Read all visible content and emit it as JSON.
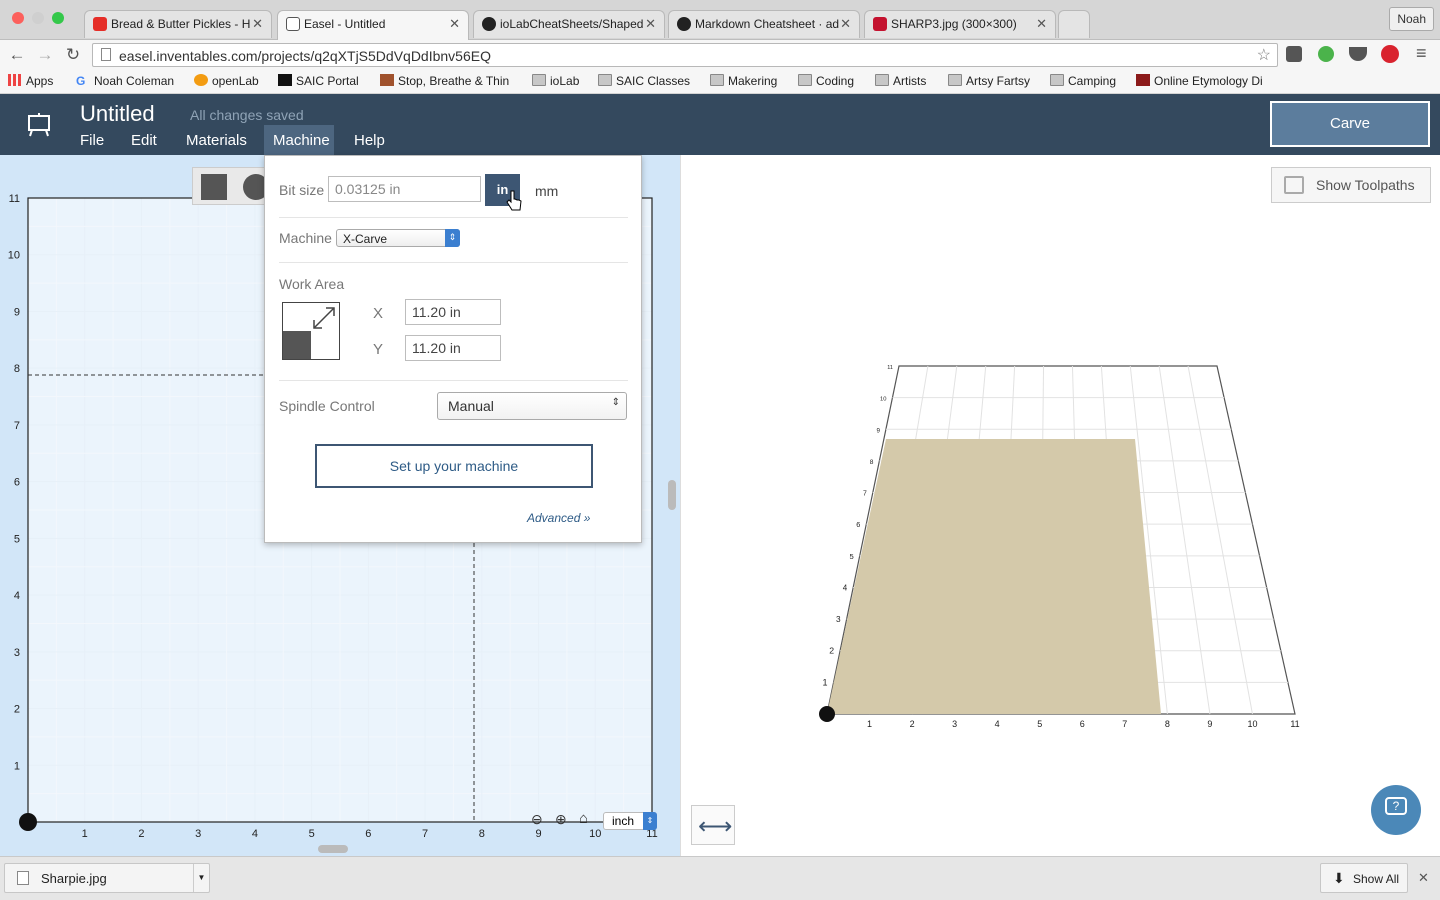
{
  "browser": {
    "tabs": [
      {
        "title": "Bread & Butter Pickles - H",
        "favicon": "youtube-icon"
      },
      {
        "title": "Easel - Untitled",
        "favicon": "easel-icon"
      },
      {
        "title": "ioLabCheatSheets/Shaped",
        "favicon": "github-icon"
      },
      {
        "title": "Markdown Cheatsheet · ad",
        "favicon": "github-icon"
      },
      {
        "title": "SHARP3.jpg (300×300)",
        "favicon": "image-icon"
      }
    ],
    "user": "Noah",
    "url": "easel.inventables.com/projects/q2qXTjS5DdVqDdIbnv56EQ",
    "bookmarks": [
      "Apps",
      "Noah Coleman",
      "openLab",
      "SAIC Portal",
      "Stop, Breathe & Thin",
      "ioLab",
      "SAIC Classes",
      "Makering",
      "Coding",
      "Artists",
      "Artsy Fartsy",
      "Camping",
      "Online Etymology Di"
    ]
  },
  "app": {
    "title": "Untitled",
    "save_status": "All changes saved",
    "menus": [
      "File",
      "Edit",
      "Materials",
      "Machine",
      "Help"
    ],
    "carve_label": "Carve",
    "accent": "#34495e"
  },
  "machine_panel": {
    "bit_size_label": "Bit size",
    "bit_size_value": "0.03125 in",
    "unit_in": "in",
    "unit_mm": "mm",
    "machine_label": "Machine",
    "machine_value": "X-Carve",
    "work_area_label": "Work Area",
    "x_label": "X",
    "x_value": "11.20 in",
    "y_label": "Y",
    "y_value": "11.20 in",
    "spindle_label": "Spindle Control",
    "spindle_value": "Manual",
    "setup_label": "Set up your machine",
    "advanced_label": "Advanced »"
  },
  "canvas": {
    "y_ticks": [
      "11",
      "10",
      "9",
      "8",
      "7",
      "6",
      "5",
      "4",
      "3",
      "2",
      "1"
    ],
    "x_ticks": [
      "1",
      "2",
      "3",
      "4",
      "5",
      "6",
      "7",
      "8",
      "9",
      "10",
      "11"
    ],
    "unit_select": "inch"
  },
  "preview": {
    "show_toolpaths_label": "Show Toolpaths",
    "x_ticks": [
      "1",
      "2",
      "3",
      "4",
      "5",
      "6",
      "7",
      "8",
      "9",
      "10",
      "11"
    ],
    "y_ticks": [
      "1",
      "2",
      "3",
      "4",
      "5",
      "6",
      "7",
      "8",
      "9",
      "10",
      "11"
    ]
  },
  "downloads": {
    "file": "Sharpie.jpg",
    "show_all_label": "Show All"
  }
}
